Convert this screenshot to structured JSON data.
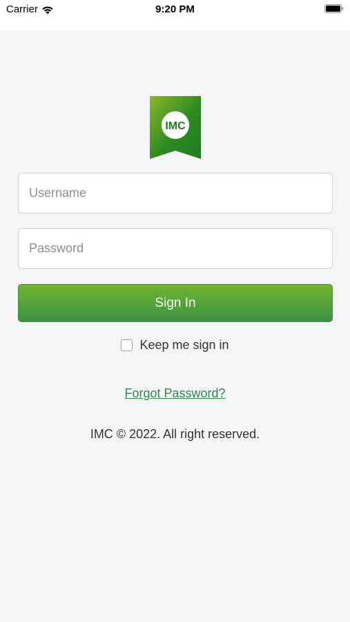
{
  "status_bar": {
    "carrier": "Carrier",
    "time": "9:20 PM",
    "icons": [
      "wifi-icon",
      "battery-icon"
    ]
  },
  "logo": {
    "text": "IMC",
    "colors": {
      "ribbon_top": "#8ab82a",
      "ribbon_bottom": "#1f7a1f",
      "text": "#1e7a1e",
      "circle": "#ffffff"
    }
  },
  "login_form": {
    "username_placeholder": "Username",
    "username_value": "",
    "password_placeholder": "Password",
    "password_value": "",
    "sign_in_label": "Sign In",
    "keep_signed_in_label": "Keep me sign in",
    "keep_signed_in_checked": false,
    "forgot_password_label": "Forgot Password?"
  },
  "footer": {
    "copyright": "IMC © 2022. All right reserved."
  },
  "colors": {
    "background": "#f4f5f7",
    "accent": "#55a33a",
    "link": "#2e8a4a"
  }
}
